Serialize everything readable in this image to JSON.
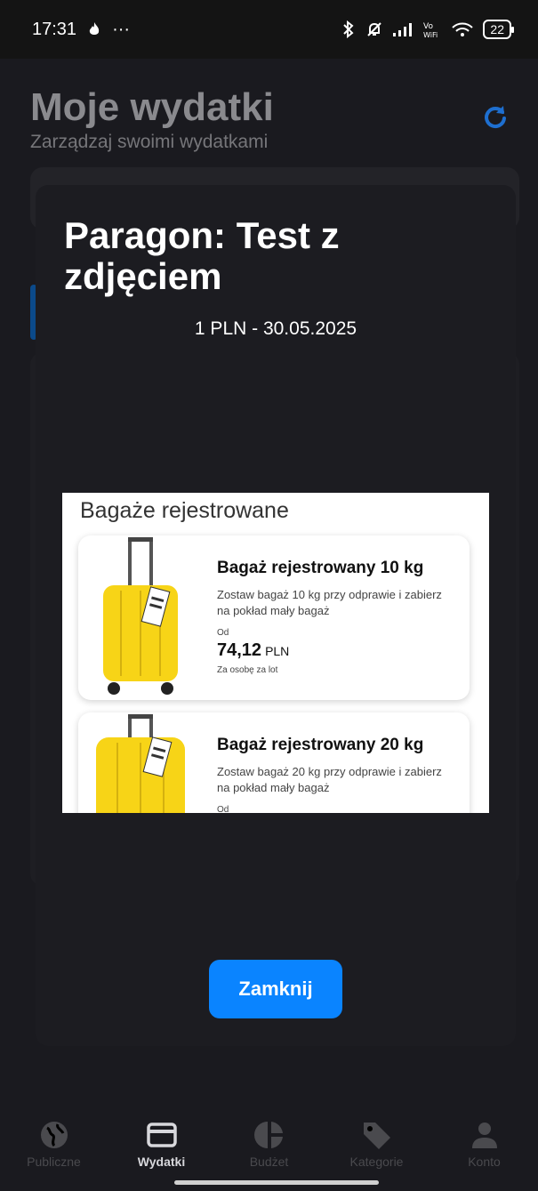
{
  "status_bar": {
    "time": "17:31",
    "dots": "···",
    "battery": "22",
    "icons": [
      "flame-icon",
      "bluetooth-icon",
      "mute-bell-icon",
      "signal-icon",
      "vowifi-icon",
      "wifi-icon",
      "battery-icon"
    ]
  },
  "app": {
    "title": "Moje wydatki",
    "subtitle": "Zarządzaj swoimi wydatkami"
  },
  "modal": {
    "title": "Paragon: Test z zdjęciem",
    "meta": "1 PLN - 30.05.2025",
    "close_label": "Zamknij",
    "accent": "#0a84ff"
  },
  "receipt": {
    "heading": "Bagaże rejestrowane",
    "offers": [
      {
        "name": "Bagaż rejestrowany 10 kg",
        "description": "Zostaw bagaż 10 kg przy odprawie i zabierz na pokład mały bagaż",
        "from_label": "Od",
        "price": "74,12",
        "currency": "PLN",
        "per": "Za osobę za lot"
      },
      {
        "name": "Bagaż rejestrowany 20 kg",
        "description": "Zostaw bagaż 20 kg przy odprawie i zabierz na pokład mały bagaż",
        "from_label": "Od"
      }
    ],
    "suitcase_color": "#f7d417"
  },
  "nav": {
    "items": [
      {
        "label": "Publiczne",
        "icon": "globe-icon",
        "active": false
      },
      {
        "label": "Wydatki",
        "icon": "card-icon",
        "active": true
      },
      {
        "label": "Budżet",
        "icon": "pie-chart-icon",
        "active": false
      },
      {
        "label": "Kategorie",
        "icon": "tag-icon",
        "active": false
      },
      {
        "label": "Konto",
        "icon": "person-icon",
        "active": false
      }
    ]
  }
}
